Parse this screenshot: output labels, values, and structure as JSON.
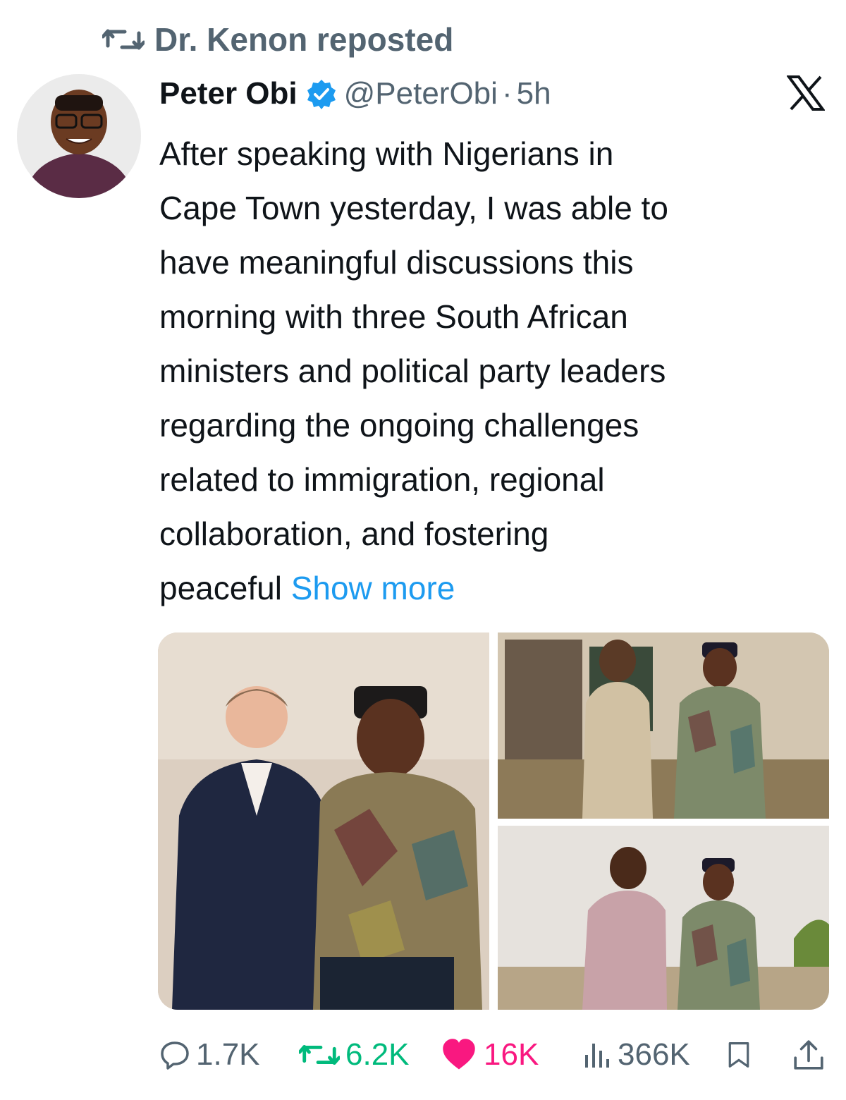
{
  "repost": {
    "label": "Dr. Kenon reposted",
    "icon": "retweet-icon"
  },
  "author": {
    "name": "Peter Obi",
    "handle": "@PeterObi",
    "separator": "·",
    "time": "5h",
    "verified": true
  },
  "tweet": {
    "text": "After speaking with Nigerians in\nCape Town yesterday, I was able to\nhave meaningful discussions this\nmorning with three South African\nministers and political party leaders\nregarding the ongoing challenges\nrelated to immigration, regional\ncollaboration, and fostering\npeaceful ",
    "show_more": "Show more"
  },
  "media": [
    {
      "icon": "photo-icon"
    },
    {
      "icon": "photo-icon"
    },
    {
      "icon": "photo-icon"
    }
  ],
  "actions": {
    "replies": "1.7K",
    "reposts": "6.2K",
    "likes": "16K",
    "views": "366K"
  },
  "colors": {
    "accent": "#1d9bf0",
    "muted": "#536471",
    "retweet": "#00ba7c",
    "like": "#f91880"
  }
}
